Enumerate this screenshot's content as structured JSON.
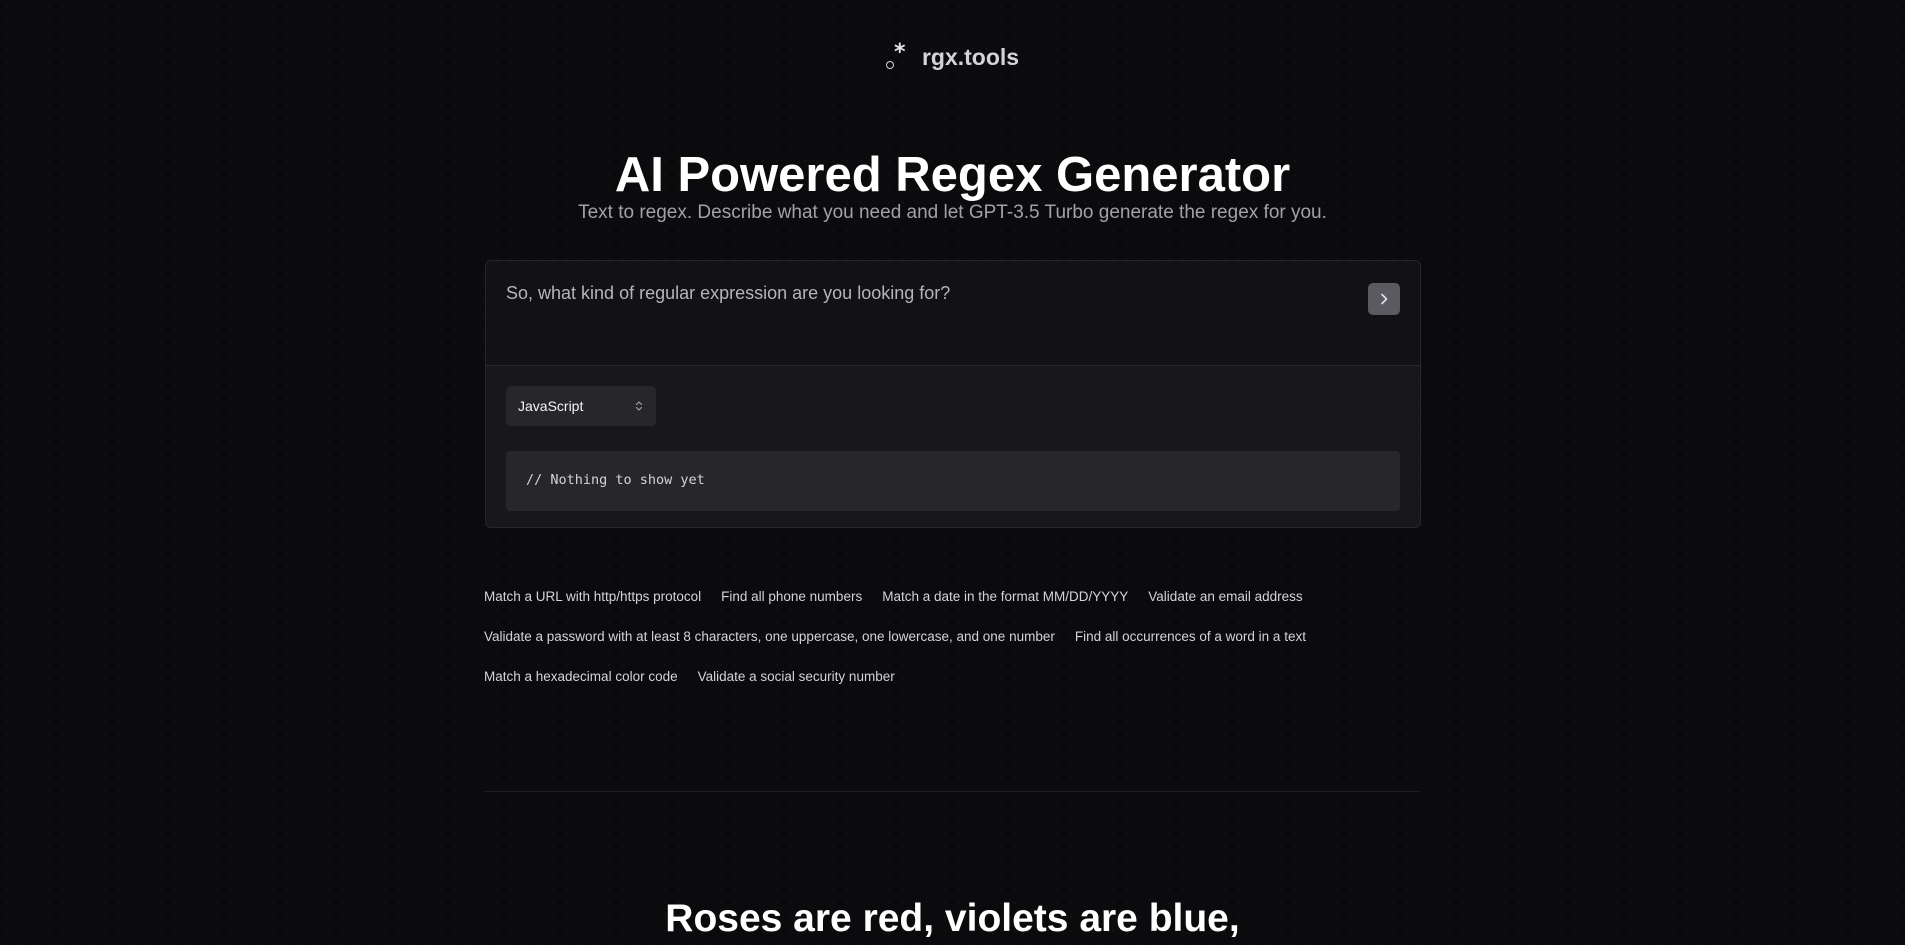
{
  "header": {
    "logo_text": "rgx.tools",
    "logo_icon": "regex-dot-star-icon"
  },
  "hero": {
    "title": "AI Powered Regex Generator",
    "subtitle": "Text to regex. Describe what you need and let GPT-3.5 Turbo generate the regex for you."
  },
  "prompt": {
    "placeholder": "So, what kind of regular expression are you looking for?",
    "value": "",
    "submit_icon": "chevron-right-icon"
  },
  "output": {
    "language_selected": "JavaScript",
    "language_icon": "chevron-up-down-icon",
    "code": "// Nothing to show yet"
  },
  "examples": [
    [
      "Match a URL with http/https protocol",
      "Find all phone numbers",
      "Match a date in the format MM/DD/YYYY",
      "Validate an email address"
    ],
    [
      "Validate a password with at least 8 characters, one uppercase, one lowercase, and one number",
      "Find all occurrences of a word in a text"
    ],
    [
      "Match a hexadecimal color code",
      "Validate a social security number"
    ]
  ],
  "poem": {
    "line1": "Roses are red, violets are blue,",
    "line2": ""
  },
  "colors": {
    "background": "#0b0b0e",
    "card": "#121215",
    "card_output": "#18181b",
    "code_box": "#27272a",
    "submit_button": "#5a5a60"
  }
}
